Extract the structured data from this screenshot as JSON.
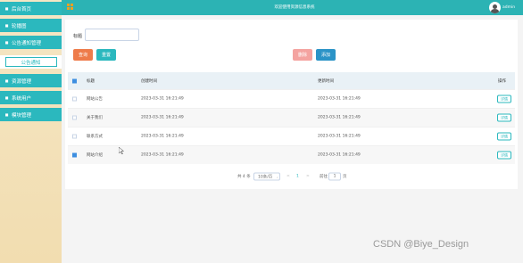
{
  "header": {
    "title": "欢迎使用资源信息系统",
    "username": "admin"
  },
  "sidebar": {
    "items": [
      {
        "label": "后台首页",
        "icon": "home-icon"
      },
      {
        "label": "轮播图",
        "icon": "image-icon"
      },
      {
        "label": "公告通知管理",
        "icon": "bell-icon"
      },
      {
        "label": "公告通知",
        "icon": ""
      },
      {
        "label": "资源管理",
        "icon": "folder-icon"
      },
      {
        "label": "系统用户",
        "icon": "user-icon"
      },
      {
        "label": "模块管理",
        "icon": "grid-icon"
      }
    ]
  },
  "search": {
    "field_label": "标题",
    "title_value": "",
    "search_label": "查询",
    "reset_label": "重置",
    "delete_label": "删除",
    "add_label": "添加"
  },
  "table": {
    "columns": [
      "标题",
      "创建时间",
      "更新时间",
      "操作"
    ],
    "rows": [
      {
        "title": "网站公告",
        "created": "2023-03-31 16:21:49",
        "updated": "2023-03-31 16:21:49",
        "action": "详情",
        "checked": false
      },
      {
        "title": "关于我们",
        "created": "2023-03-31 16:21:49",
        "updated": "2023-03-31 16:21:49",
        "action": "详情",
        "checked": false
      },
      {
        "title": "联系方式",
        "created": "2023-03-31 16:21:49",
        "updated": "2023-03-31 16:21:49",
        "action": "详情",
        "checked": false
      },
      {
        "title": "网站介绍",
        "created": "2023-03-31 16:21:49",
        "updated": "2023-03-31 16:21:49",
        "action": "详情",
        "checked": true
      }
    ]
  },
  "pager": {
    "total": "共 4 条",
    "page_size": "10条/页",
    "prev": "<",
    "current": "1",
    "next": ">",
    "goto": "前往",
    "goto_value": "1",
    "page_unit": "页"
  },
  "watermark": "CSDN @Biye_Design",
  "colors": {
    "accent": "#2bb8be",
    "search_button": "#ee7b4a",
    "delete_button": "#f4a3a0",
    "add_button": "#2b93c7"
  }
}
